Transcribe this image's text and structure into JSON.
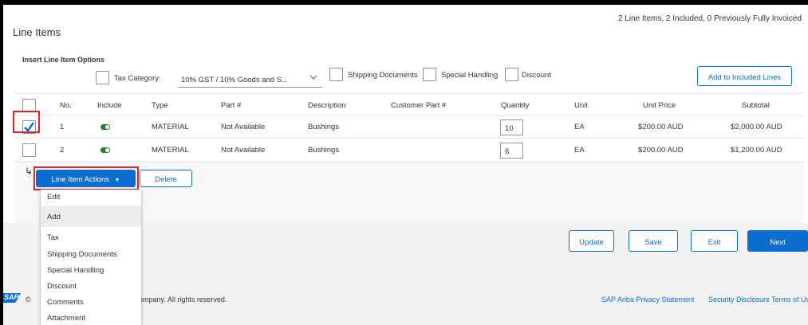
{
  "header": {
    "title": "Line Items",
    "summary": "2 Line Items,  2 Included,  0 Previously Fully Invoiced"
  },
  "options": {
    "title": "Insert Line Item Options",
    "tax_category_label": "Tax Category:",
    "tax_category_value": "10% GST / 10% Goods and S...",
    "shipping_documents": "Shipping Documents",
    "special_handling": "Special Handling",
    "discount": "Discount",
    "add_button": "Add to Included Lines"
  },
  "table": {
    "headers": {
      "no": "No.",
      "include": "Include",
      "type": "Type",
      "part": "Part #",
      "description": "Description",
      "customer_part": "Customer Part #",
      "quantity": "Quantity",
      "unit": "Unit",
      "unit_price": "Unit Price",
      "subtotal": "Subtotal"
    },
    "rows": [
      {
        "no": "1",
        "type": "MATERIAL",
        "part": "Not Available",
        "description": "Bushings",
        "quantity": "10",
        "unit": "EA",
        "unit_price": "$200.00 AUD",
        "subtotal": "$2,000.00 AUD",
        "selected": true
      },
      {
        "no": "2",
        "type": "MATERIAL",
        "part": "Not Available",
        "description": "Bushings",
        "quantity": "6",
        "unit": "EA",
        "unit_price": "$200.00 AUD",
        "subtotal": "$1,200.00 AUD",
        "selected": false
      }
    ]
  },
  "actions": {
    "line_item_actions": "Line Item Actions",
    "delete": "Delete",
    "arrow": "↳"
  },
  "menu": {
    "edit": "Edit",
    "add": "Add",
    "items": [
      "Tax",
      "Shipping Documents",
      "Special Handling",
      "Discount",
      "Comments",
      "Attachment"
    ]
  },
  "buttons": {
    "update": "Update",
    "save": "Save",
    "exit": "Exit",
    "next": "Next"
  },
  "footer": {
    "logo": "SAP",
    "copyright_start": "©",
    "copyright_end": "ompany. All rights reserved.",
    "privacy": "SAP Ariba Privacy Statement",
    "security": "Security Disclosure",
    "terms": "Terms of Use"
  },
  "colors": {
    "accent": "#0a6ed1",
    "highlight": "#e0212a",
    "include_toggle": "#2b7c2b"
  }
}
